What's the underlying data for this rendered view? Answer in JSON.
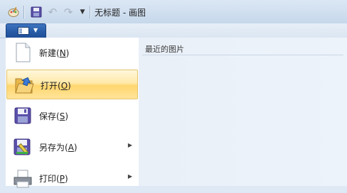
{
  "window": {
    "title": "无标题 - 画图"
  },
  "quick_access": {
    "icons": [
      "paint-app-icon",
      "save-icon",
      "undo-icon",
      "redo-icon",
      "customize-dropdown-icon"
    ]
  },
  "app_menu": {
    "button_icon": "app-menu-icon",
    "items": [
      {
        "label": "新建(",
        "key": "N",
        "close": ")",
        "icon": "new-file-icon",
        "submenu": false
      },
      {
        "label": "打开(",
        "key": "O",
        "close": ")",
        "icon": "open-folder-icon",
        "submenu": false,
        "highlighted": true
      },
      {
        "label": "保存(",
        "key": "S",
        "close": ")",
        "icon": "save-icon",
        "submenu": false
      },
      {
        "label": "另存为(",
        "key": "A",
        "close": ")",
        "icon": "save-as-icon",
        "submenu": true
      },
      {
        "label": "打印(",
        "key": "P",
        "close": ")",
        "icon": "print-icon",
        "submenu": true
      }
    ]
  },
  "recent": {
    "title": "最近的图片"
  },
  "colors": {
    "highlight": "#ffd66e",
    "menu_button": "#2a5ea8"
  }
}
